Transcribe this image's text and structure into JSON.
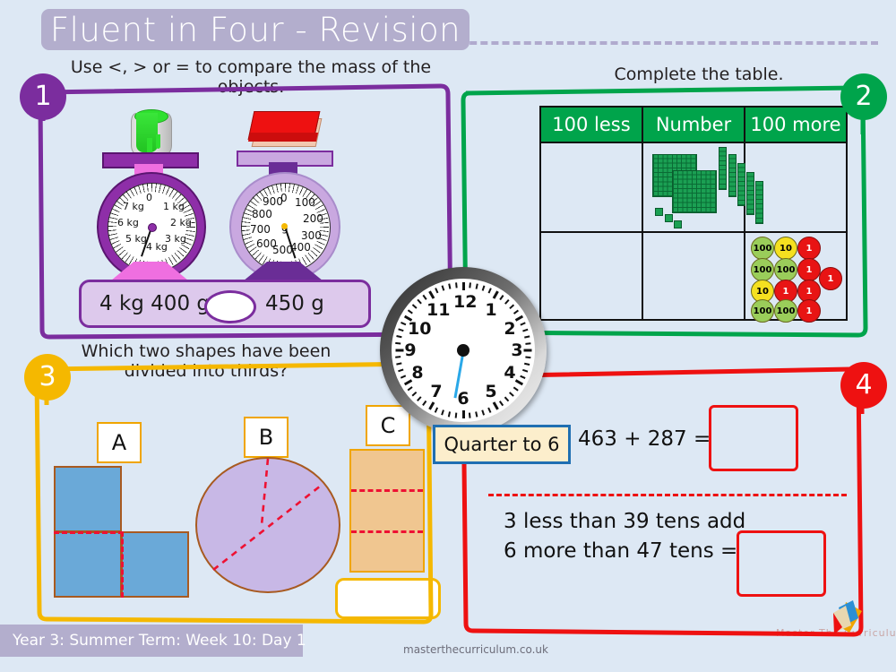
{
  "header": {
    "title": "Fluent in Four - Revision"
  },
  "footer": {
    "lesson": "Year 3: Summer Term: Week 10: Day 1",
    "website": "masterthecurriculum.co.uk",
    "brand": "Master  The  Curriculum"
  },
  "colors": {
    "background": "#dde8f4",
    "title_bar": "#b3aecd",
    "q1_purple": "#7b2d9e",
    "q2_green": "#00a44b",
    "q3_orange": "#f5b800",
    "q4_red": "#ee1111",
    "clock_hand": "#2aa8e8",
    "counter_hundred": "#9acd5a",
    "counter_ten": "#f5e020",
    "counter_one": "#e81414"
  },
  "questions": [
    {
      "number": "1",
      "prompt": "Use <, > or = to compare the mass of the objects.",
      "left_scale": {
        "object": "paint-tin",
        "unit_label": "kg",
        "zero_label": "0",
        "ticks": [
          "1 kg",
          "2 kg",
          "3 kg",
          "4 kg",
          "5 kg",
          "6 kg",
          "7 kg"
        ],
        "reading": "4 kg 400 g"
      },
      "right_scale": {
        "object": "book",
        "unit_label": "g",
        "zero_label": "0",
        "ticks": [
          "100",
          "200",
          "300",
          "400",
          "500",
          "600",
          "700",
          "800",
          "900"
        ],
        "reading": "450 g"
      },
      "compare_left": "4 kg 400 g",
      "compare_right": "450 g",
      "compare_answer": ""
    },
    {
      "number": "2",
      "prompt": "Complete the table.",
      "table": {
        "columns": [
          "100 less",
          "Number",
          "100 more"
        ],
        "rows": [
          {
            "100 less": "",
            "Number": "base-ten-blocks-253",
            "100 more": ""
          },
          {
            "100 less": "",
            "Number": "",
            "100 more": "place-value-counters-536"
          }
        ]
      },
      "base_ten": {
        "hundreds": 2,
        "tens": 5,
        "ones": 3,
        "value": "253"
      },
      "counters": {
        "rows": [
          [
            "100",
            "10",
            "1"
          ],
          [
            "100",
            "100",
            "1",
            "1"
          ],
          [
            "10",
            "1",
            "1"
          ],
          [
            "100",
            "100",
            "1"
          ]
        ],
        "hundreds": 5,
        "tens": 2,
        "ones": 6,
        "value": "536"
      }
    },
    {
      "number": "3",
      "prompt": "Which two shapes have been divided into thirds?",
      "shapes": [
        {
          "label": "A",
          "kind": "l-shape",
          "parts": 3,
          "equal": true
        },
        {
          "label": "B",
          "kind": "circle",
          "parts": 3,
          "equal": false
        },
        {
          "label": "C",
          "kind": "rectangle",
          "parts": 3,
          "equal": true
        }
      ],
      "answer": ""
    },
    {
      "number": "4",
      "prompt": "",
      "line1": "463 + 287 =",
      "line1_answer": "",
      "line2a": "3 less than 39 tens add",
      "line2b": "6 more than 47 tens =",
      "line2_answer": ""
    }
  ],
  "clock": {
    "numbers": [
      "12",
      "1",
      "2",
      "3",
      "4",
      "5",
      "6",
      "7",
      "8",
      "9",
      "10",
      "11"
    ],
    "hand_points_to": "6",
    "time_label": "Quarter to 6"
  }
}
